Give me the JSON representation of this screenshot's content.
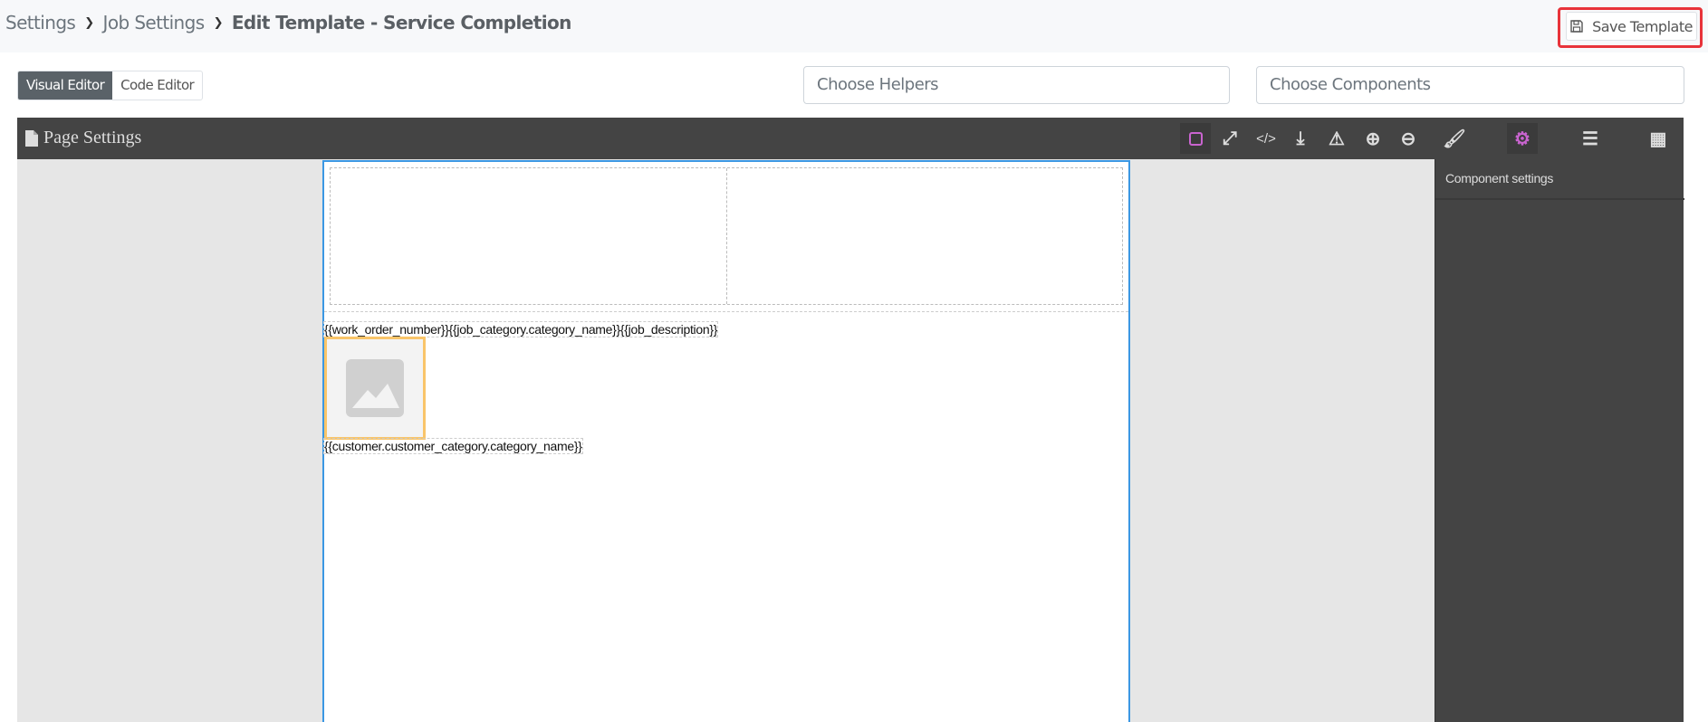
{
  "breadcrumb": {
    "items": [
      "Settings",
      "Job Settings"
    ],
    "current": "Edit Template - Service Completion"
  },
  "save_button": "Save Template",
  "editor_tabs": [
    "Visual Editor",
    "Code Editor"
  ],
  "helpers_placeholder": "Choose Helpers",
  "components_placeholder": "Choose Components",
  "editor": {
    "title": "Page Settings",
    "toolbar_icons": [
      "square-outline-icon",
      "fullscreen-icon",
      "code-icon",
      "download-icon",
      "warning-icon",
      "zoom-in-icon",
      "zoom-out-icon"
    ],
    "panel_icons": [
      "brush-icon",
      "gear-icon",
      "layers-icon",
      "blocks-icon"
    ],
    "panel_heading": "Component settings"
  },
  "canvas": {
    "line1": "{{work_order_number}}{{job_category.category_name}}{{job_description}}",
    "line2": "{{customer.customer_category.category_name}}"
  },
  "colors": {
    "accent": "#3b97e3",
    "selected": "#f9c56a",
    "active_icon": "#c964cf",
    "highlight": "#e8333a"
  }
}
